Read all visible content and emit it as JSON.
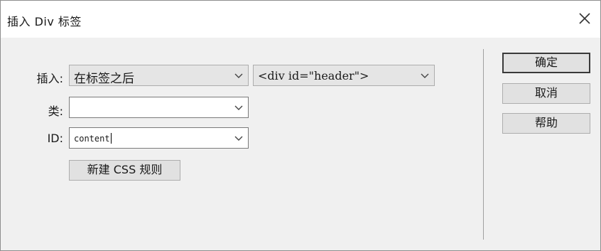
{
  "window": {
    "title": "插入 Div 标签",
    "close_icon": "close-icon"
  },
  "form": {
    "insert": {
      "label": "插入:",
      "value": "在标签之后",
      "target_value": "<div id=\"header\">"
    },
    "class": {
      "label": "类:",
      "value": ""
    },
    "id": {
      "label": "ID:",
      "value": "content"
    },
    "new_css_rule_label": "新建 CSS 规则"
  },
  "buttons": {
    "ok": "确定",
    "cancel": "取消",
    "help": "帮助"
  }
}
